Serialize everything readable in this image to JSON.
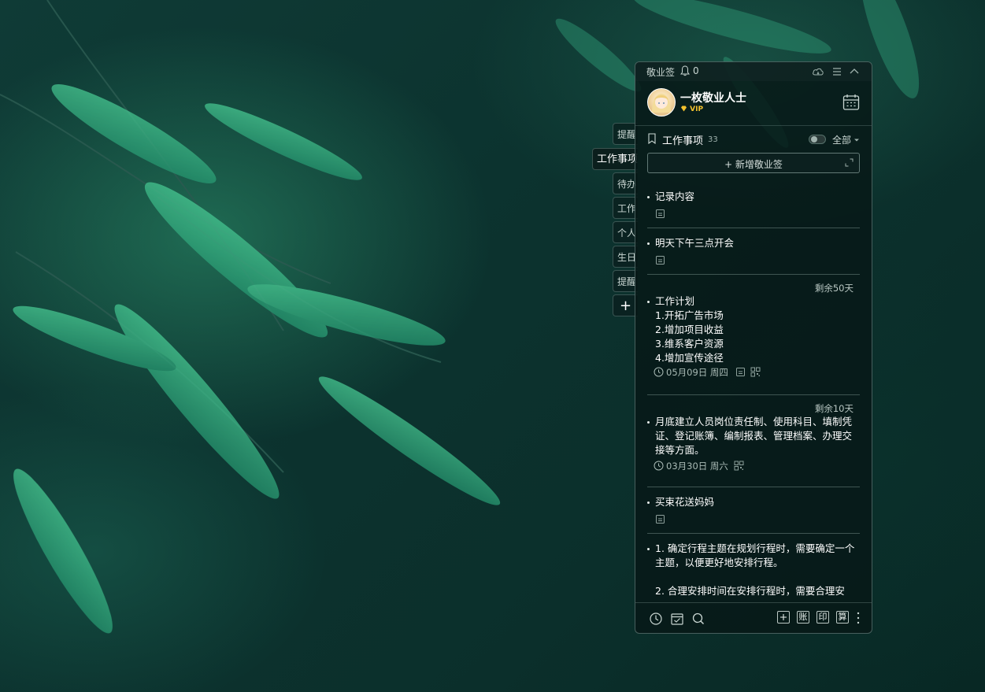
{
  "app": {
    "name": "敬业签",
    "notification_count": "0"
  },
  "user": {
    "name": "一枚敬业人士",
    "badge": "VIP"
  },
  "side_tabs": [
    {
      "label": "提醒"
    },
    {
      "label": "工作事项",
      "active": true
    },
    {
      "label": "待办"
    },
    {
      "label": "工作"
    },
    {
      "label": "个人"
    },
    {
      "label": "生日"
    },
    {
      "label": "提醒"
    },
    {
      "label": "+"
    }
  ],
  "section": {
    "title": "工作事项",
    "count": "33",
    "filter": "全部"
  },
  "add_note": {
    "label": "+ 新增敬业签"
  },
  "notes": [
    {
      "text": "记录内容"
    },
    {
      "text": "明天下午三点开会"
    },
    {
      "remaining": "剩余50天",
      "text": "工作计划\n1.开拓广告市场\n2.增加项目收益\n3.维系客户资源\n4.增加宣传途径",
      "date": "05月09日 周四"
    },
    {
      "remaining": "剩余10天",
      "text": "月底建立人员岗位责任制、使用科目、填制凭证、登记账簿、编制报表、管理档案、办理交接等方面。",
      "date": "03月30日 周六"
    },
    {
      "text": "买束花送妈妈"
    },
    {
      "text": "1. 确定行程主题在规划行程时，需要确定一个主题，以便更好地安排行程。\n\n2. 合理安排时间在安排行程时，需要合理安"
    }
  ],
  "footer": {
    "btn_account": "账",
    "btn_print": "印",
    "btn_calc": "算"
  },
  "colors": {
    "accent_vip": "#f2c12e",
    "panel_bg": "#071817",
    "text": "#ffffff"
  }
}
